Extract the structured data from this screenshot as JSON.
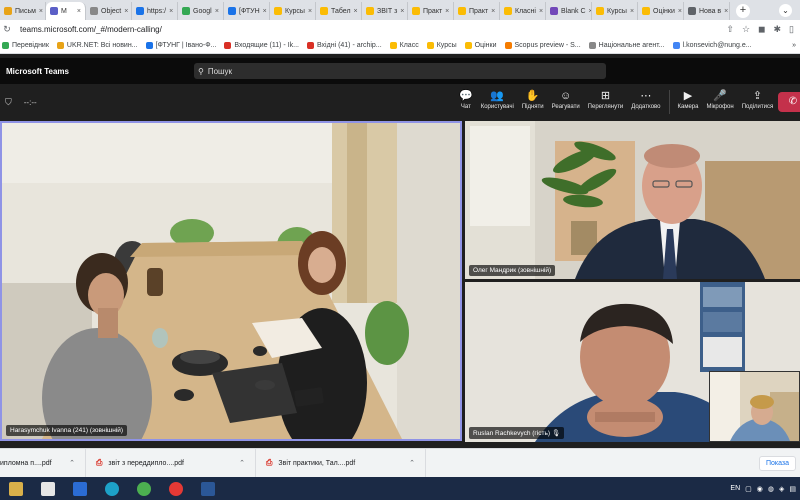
{
  "browser": {
    "tabs": [
      {
        "label": "Письм",
        "color": "#e8a317"
      },
      {
        "label": "M",
        "color": "#5b5fc7",
        "active": true
      },
      {
        "label": "Object",
        "color": "#888888"
      },
      {
        "label": "https:/",
        "color": "#1a73e8"
      },
      {
        "label": "Googl",
        "color": "#34a853"
      },
      {
        "label": "[ФТУН",
        "color": "#1a73e8"
      },
      {
        "label": "Курсы",
        "color": "#fbbc04"
      },
      {
        "label": "Табел",
        "color": "#fbbc04"
      },
      {
        "label": "ЗВІТ з",
        "color": "#fbbc04"
      },
      {
        "label": "Практ",
        "color": "#fbbc04"
      },
      {
        "label": "Практ",
        "color": "#fbbc04"
      },
      {
        "label": "Класні",
        "color": "#fbbc04"
      },
      {
        "label": "Blank C",
        "color": "#7248b9"
      },
      {
        "label": "Курсы",
        "color": "#fbbc04"
      },
      {
        "label": "Оцінки",
        "color": "#fbbc04"
      },
      {
        "label": "Нова в",
        "color": "#5f6368"
      }
    ],
    "url": "teams.microsoft.com/_#/modern-calling/",
    "bookmarks": [
      {
        "label": "Перевідник",
        "color": "#34a853"
      },
      {
        "label": "UKR.NET: Всі новин...",
        "color": "#e8a317"
      },
      {
        "label": "[ФТУНГ | Івано-Ф...",
        "color": "#1a73e8"
      },
      {
        "label": "Входящие (11) - Ik...",
        "color": "#d93025"
      },
      {
        "label": "Вхідні (41) - archip...",
        "color": "#d93025"
      },
      {
        "label": "Класс",
        "color": "#fbbc04"
      },
      {
        "label": "Курсы",
        "color": "#fbbc04"
      },
      {
        "label": "Оцінки",
        "color": "#fbbc04"
      },
      {
        "label": "Scopus preview - S...",
        "color": "#f57c00"
      },
      {
        "label": "Національне агент...",
        "color": "#888888"
      },
      {
        "label": "l.konsevich@nung.e...",
        "color": "#4285f4"
      }
    ]
  },
  "teams": {
    "app_title": "Microsoft Teams",
    "search_placeholder": "Пошук",
    "call_timer": "--:--",
    "controls": [
      {
        "label": "Чат",
        "icon": "chat-icon",
        "glyph": "💬"
      },
      {
        "label": "Користувачі",
        "icon": "people-icon",
        "glyph": "👥"
      },
      {
        "label": "Підняти",
        "icon": "raise-hand-icon",
        "glyph": "✋"
      },
      {
        "label": "Реагувати",
        "icon": "react-icon",
        "glyph": "☺"
      },
      {
        "label": "Переглянути",
        "icon": "view-icon",
        "glyph": "⊞"
      },
      {
        "label": "Додатково",
        "icon": "more-icon",
        "glyph": "⋯"
      }
    ],
    "media_controls": [
      {
        "label": "Камера",
        "icon": "camera-icon",
        "glyph": "▶"
      },
      {
        "label": "Мікрофон",
        "icon": "microphone-icon",
        "glyph": "🎤"
      },
      {
        "label": "Поділитися",
        "icon": "share-icon",
        "glyph": "⇪"
      }
    ],
    "participants": {
      "main": "Harasymchuk Ivanna (241) (зовнішній)",
      "right_top": "Олег Мандрик (зовнішній)",
      "right_bottom": "Ruslan Rachkevych (гість)"
    }
  },
  "downloads": {
    "items": [
      {
        "name": "ипломна п....pdf"
      },
      {
        "name": "звіт з переддипло....pdf"
      },
      {
        "name": "Звіт практики, Тал....pdf"
      }
    ],
    "show_all": "Показа"
  },
  "taskbar": {
    "lang": "EN",
    "icons": [
      "file-explorer-icon",
      "file-icon",
      "store-icon",
      "edge-icon",
      "chrome-icon",
      "chrome-icon-2",
      "word-icon"
    ],
    "icon_colors": [
      "#d9b04a",
      "#e5e5e5",
      "#2b6cd4",
      "#1da1c8",
      "#4caf50",
      "#e53935",
      "#2b5797"
    ]
  }
}
